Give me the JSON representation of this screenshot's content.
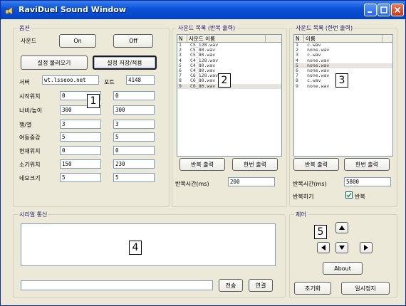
{
  "window": {
    "title": "RaviDuel Sound Window"
  },
  "options": {
    "legend": "옵션",
    "sound_label": "사운드",
    "on_label": "On",
    "off_label": "Off",
    "load_settings_label": "설정 불러오기",
    "save_apply_label": "설정 저장/적용",
    "server_label": "서버",
    "server_value": "wt.lsseoo.net",
    "port_label": "포트",
    "port_value": "4148",
    "rows": [
      {
        "label": "시작위치",
        "v1": "0",
        "v2": "0"
      },
      {
        "label": "너비/높이",
        "v1": "300",
        "v2": "300"
      },
      {
        "label": "행/열",
        "v1": "3",
        "v2": "3"
      },
      {
        "label": "여동중감",
        "v1": "5",
        "v2": "5"
      },
      {
        "label": "현재위치",
        "v1": "0",
        "v2": "0"
      },
      {
        "label": "소기위치",
        "v1": "150",
        "v2": "230"
      },
      {
        "label": "네모크기",
        "v1": "5",
        "v2": "5"
      }
    ],
    "callout": "1"
  },
  "repeat_list": {
    "legend": "사운드 목록 (반복 출력)",
    "col_n": "N",
    "col_name": "사운드 이름",
    "items": [
      {
        "n": "1",
        "name": "C5_128.wav"
      },
      {
        "n": "2",
        "name": "C5_80.wav"
      },
      {
        "n": "3",
        "name": "C5_80.wav"
      },
      {
        "n": "4",
        "name": "C4_128.wav"
      },
      {
        "n": "5",
        "name": "C4_80.wav"
      },
      {
        "n": "6",
        "name": "C4_80.wav"
      },
      {
        "n": "7",
        "name": "C6_128.wav"
      },
      {
        "n": "8",
        "name": "C6_80.wav"
      },
      {
        "n": "9",
        "name": "C6_80.wav"
      }
    ],
    "callout": "2",
    "repeat_btn": "반복 출력",
    "once_btn": "한번 출력",
    "repeat_time_label": "반복시간(ms)",
    "repeat_time_value": "200"
  },
  "once_list": {
    "legend": "사운드 목록 (한번 출력)",
    "col_n": "N",
    "col_name": "이름",
    "items": [
      {
        "n": "1",
        "name": "c.wav"
      },
      {
        "n": "2",
        "name": "none.wav"
      },
      {
        "n": "3",
        "name": "c.wav"
      },
      {
        "n": "4",
        "name": "none.wav"
      },
      {
        "n": "5",
        "name": "none.wav"
      },
      {
        "n": "6",
        "name": "none.wav"
      },
      {
        "n": "7",
        "name": "none.wav"
      },
      {
        "n": "8",
        "name": "c.wav"
      },
      {
        "n": "9",
        "name": "none.wav"
      }
    ],
    "callout": "3",
    "repeat_btn": "반복 출력",
    "once_btn": "한번 출력",
    "repeat_time_label": "반복시간(ms)",
    "repeat_time_value": "5800",
    "repeat_check_label": "반복하기",
    "repeat_check_caption": "반복"
  },
  "serial": {
    "legend": "시리얼 통신",
    "callout": "4",
    "send_label": "전송",
    "connect_label": "연결"
  },
  "control": {
    "legend": "제어",
    "callout": "5",
    "about_label": "About",
    "init_label": "초기화",
    "pause_label": "일시정지"
  },
  "icons": {
    "up": "arrow-up-icon",
    "down": "arrow-down-icon",
    "left": "arrow-left-icon",
    "right": "arrow-right-icon"
  }
}
